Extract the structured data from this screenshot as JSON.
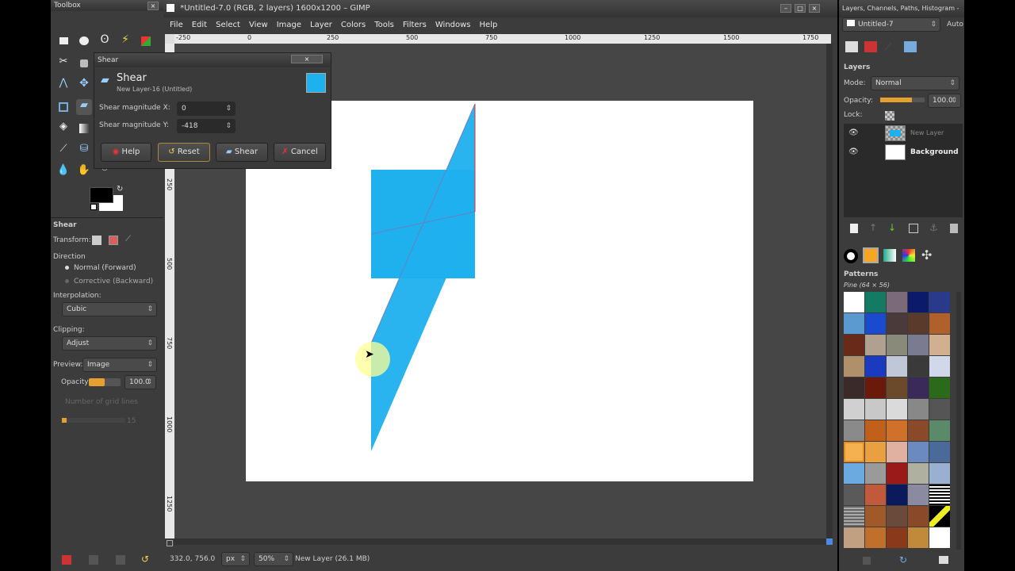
{
  "toolbox": {
    "title": "Toolbox",
    "tool_options_title": "Shear",
    "transform_label": "Transform:",
    "direction_label": "Direction",
    "direction_normal": "Normal (Forward)",
    "direction_corrective": "Corrective (Backward)",
    "interpolation_label": "Interpolation:",
    "interpolation_value": "Cubic",
    "clipping_label": "Clipping:",
    "clipping_value": "Adjust",
    "preview_label": "Preview:",
    "preview_value": "Image",
    "opacity_label": "Opacity:",
    "opacity_value": "100.0",
    "grid_lines_label": "Number of grid lines",
    "grid_lines_value": "15"
  },
  "image_window": {
    "title": "*Untitled-7.0 (RGB, 2 layers) 1600x1200 – GIMP",
    "menu": [
      "File",
      "Edit",
      "Select",
      "View",
      "Image",
      "Layer",
      "Colors",
      "Tools",
      "Filters",
      "Windows",
      "Help"
    ],
    "ruler_h": [
      "-250",
      "0",
      "250",
      "500",
      "750",
      "1000",
      "1250",
      "1500",
      "1750"
    ],
    "ruler_v": [
      "250",
      "500",
      "750",
      "1000",
      "1250"
    ],
    "status": {
      "coords": "332.0, 756.0",
      "unit": "px",
      "zoom": "50%",
      "layer_info": "New Layer (26.1 MB)"
    }
  },
  "shear_dialog": {
    "window_title": "Shear",
    "heading": "Shear",
    "subheading": "New Layer-16 (Untitled)",
    "mag_x_label": "Shear magnitude X:",
    "mag_x_value": "0",
    "mag_y_label": "Shear magnitude Y:",
    "mag_y_value": "-418",
    "help_label": "Help",
    "reset_label": "Reset",
    "shear_label": "Shear",
    "cancel_label": "Cancel",
    "swatch_color": "#1fb0ee"
  },
  "dock": {
    "title": "Layers, Channels, Paths, Histogram - B...",
    "image_selector": "Untitled-7",
    "auto_label": "Auto",
    "layers_title": "Layers",
    "mode_label": "Mode:",
    "mode_value": "Normal",
    "opacity_label": "Opacity:",
    "opacity_value": "100.0",
    "lock_label": "Lock:",
    "layers": [
      {
        "name": "New Layer"
      },
      {
        "name": "Background"
      }
    ],
    "patterns_title": "Patterns",
    "pattern_selected": "Pine (64 × 56)"
  },
  "colors": {
    "shape_fill": "#1fb0ee",
    "canvas": "#ffffff",
    "panel": "#3c3c3c"
  }
}
